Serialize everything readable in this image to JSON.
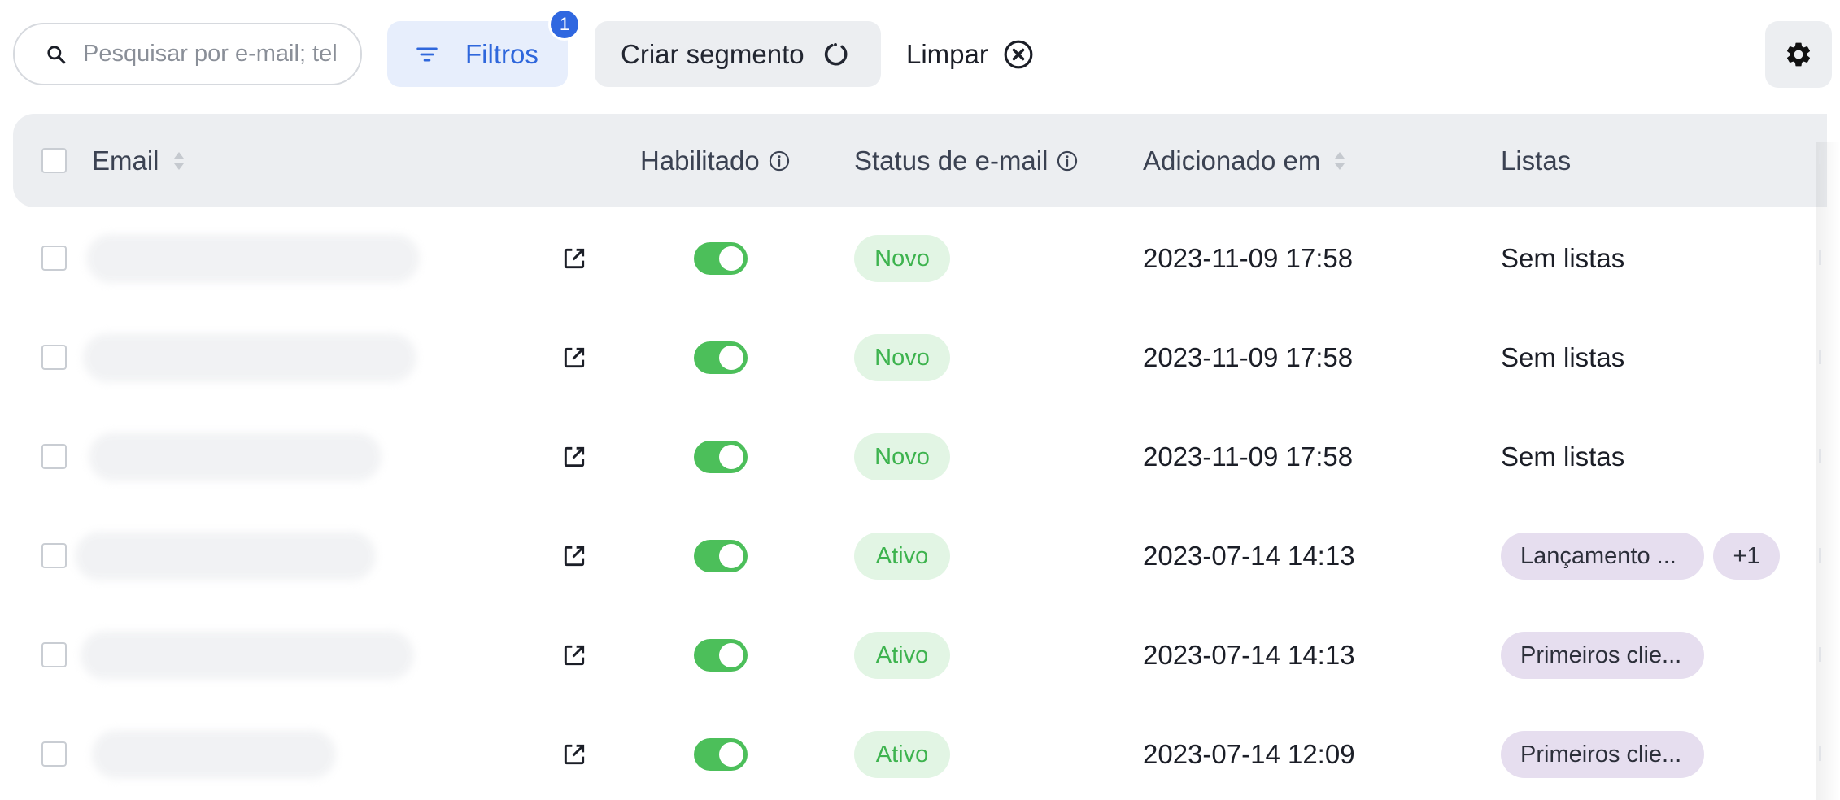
{
  "toolbar": {
    "search_placeholder": "Pesquisar por e-mail; tel",
    "filters_label": "Filtros",
    "filters_badge": "1",
    "segment_label": "Criar segmento",
    "clear_label": "Limpar"
  },
  "table": {
    "headers": {
      "email": "Email",
      "enabled": "Habilitado",
      "email_status": "Status de e-mail",
      "added_at": "Adicionado em",
      "lists": "Listas"
    },
    "rows": [
      {
        "status": "Novo",
        "added": "2023-11-09 17:58",
        "lists_text": "Sem listas",
        "tags": []
      },
      {
        "status": "Novo",
        "added": "2023-11-09 17:58",
        "lists_text": "Sem listas",
        "tags": []
      },
      {
        "status": "Novo",
        "added": "2023-11-09 17:58",
        "lists_text": "Sem listas",
        "tags": []
      },
      {
        "status": "Ativo",
        "added": "2023-07-14 14:13",
        "lists_text": "",
        "tags": [
          "Lançamento ...",
          "+1"
        ]
      },
      {
        "status": "Ativo",
        "added": "2023-07-14 14:13",
        "lists_text": "",
        "tags": [
          "Primeiros clie..."
        ]
      },
      {
        "status": "Ativo",
        "added": "2023-07-14 12:09",
        "lists_text": "",
        "tags": [
          "Primeiros clie..."
        ]
      }
    ]
  },
  "icons": {
    "search": "search-icon",
    "filter": "filter-lines-icon",
    "segment": "refresh-loader-icon",
    "clear": "close-circle-icon",
    "settings": "gear-icon",
    "sort": "sort-icon",
    "info": "info-circle-icon",
    "external": "external-link-icon"
  },
  "colors": {
    "accent": "#2f67dc",
    "toggle_on": "#4cbf5a",
    "status_bg": "#e2f5e4",
    "status_text": "#3db34e",
    "tag_bg": "#e6deef",
    "header_bg": "#eceef1"
  }
}
